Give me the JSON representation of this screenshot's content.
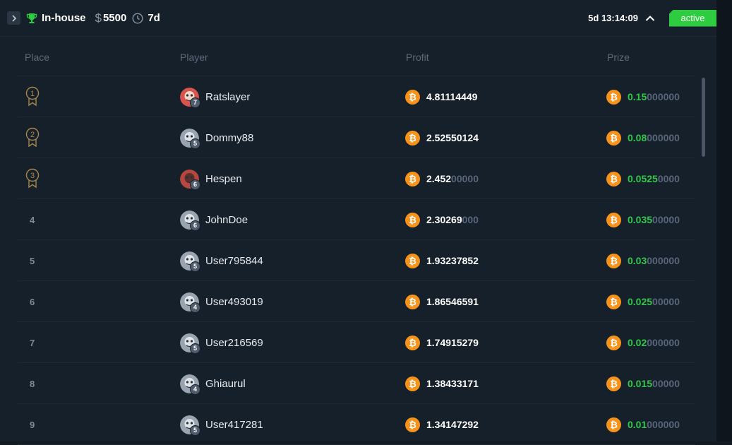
{
  "header": {
    "title": "In-house",
    "currency_symbol": "$",
    "prize_pool": "5500",
    "duration": "7d",
    "countdown": "5d 13:14:09",
    "status": "active"
  },
  "columns": {
    "place": "Place",
    "player": "Player",
    "profit": "Profit",
    "prize": "Prize"
  },
  "rows": [
    {
      "place": "1",
      "name": "Ratslayer",
      "level": "7",
      "profit_main": "4.81114449",
      "profit_dim": "",
      "prize_main": "0.15",
      "prize_dim": "000000"
    },
    {
      "place": "2",
      "name": "Dommy88",
      "level": "5",
      "profit_main": "2.52550124",
      "profit_dim": "",
      "prize_main": "0.08",
      "prize_dim": "000000"
    },
    {
      "place": "3",
      "name": "Hespen",
      "level": "6",
      "profit_main": "2.452",
      "profit_dim": "00000",
      "prize_main": "0.0525",
      "prize_dim": "0000"
    },
    {
      "place": "4",
      "name": "JohnDoe",
      "level": "6",
      "profit_main": "2.30269",
      "profit_dim": "000",
      "prize_main": "0.035",
      "prize_dim": "00000"
    },
    {
      "place": "5",
      "name": "User795844",
      "level": "5",
      "profit_main": "1.93237852",
      "profit_dim": "",
      "prize_main": "0.03",
      "prize_dim": "000000"
    },
    {
      "place": "6",
      "name": "User493019",
      "level": "4",
      "profit_main": "1.86546591",
      "profit_dim": "",
      "prize_main": "0.025",
      "prize_dim": "00000"
    },
    {
      "place": "7",
      "name": "User216569",
      "level": "5",
      "profit_main": "1.74915279",
      "profit_dim": "",
      "prize_main": "0.02",
      "prize_dim": "000000"
    },
    {
      "place": "8",
      "name": "Ghiaurul",
      "level": "4",
      "profit_main": "1.38433171",
      "profit_dim": "",
      "prize_main": "0.015",
      "prize_dim": "00000"
    },
    {
      "place": "9",
      "name": "User417281",
      "level": "5",
      "profit_main": "1.34147292",
      "profit_dim": "",
      "prize_main": "0.01",
      "prize_dim": "000000"
    }
  ],
  "icons": {
    "trophy": "trophy-icon",
    "dollar": "dollar-icon",
    "clock": "clock-icon",
    "medal": "medal-icon",
    "bitcoin": "bitcoin-icon",
    "expand": "chevron-right-icon",
    "collapse": "chevron-up-icon"
  },
  "colors": {
    "accent_green": "#2ecc40",
    "prize_green": "#31c84a",
    "bitcoin_orange": "#f7931a",
    "medal_gold": "#a8874a",
    "background": "#16202a"
  }
}
